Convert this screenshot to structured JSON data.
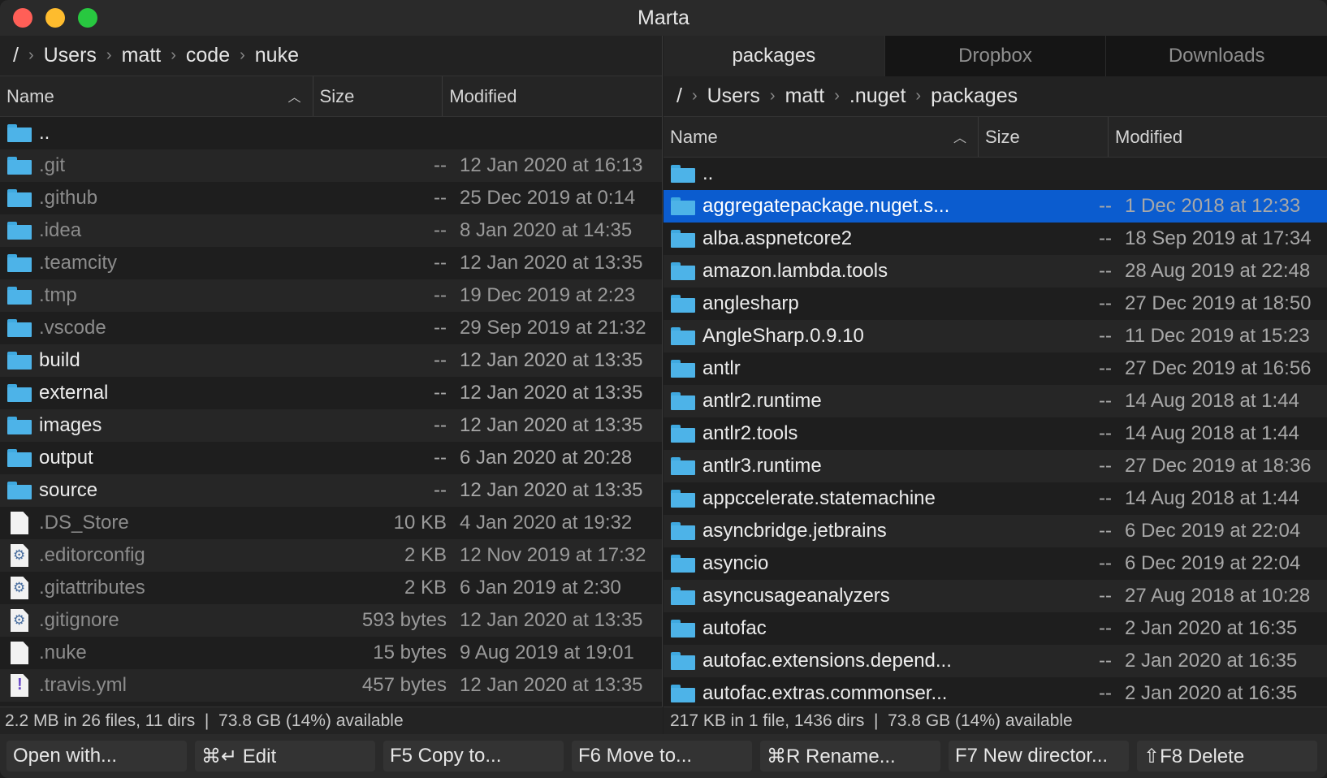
{
  "window": {
    "title": "Marta"
  },
  "left_pane": {
    "breadcrumb": [
      "/",
      "Users",
      "matt",
      "code",
      "nuke"
    ],
    "columns": {
      "name": "Name",
      "size": "Size",
      "modified": "Modified"
    },
    "rows": [
      {
        "icon": "folder-icon",
        "name": "..",
        "size": "",
        "modified": "",
        "style": "bright"
      },
      {
        "icon": "folder-icon",
        "name": ".git",
        "size": "--",
        "modified": "12 Jan 2020 at 16:13",
        "style": "dim"
      },
      {
        "icon": "folder-icon",
        "name": ".github",
        "size": "--",
        "modified": "25 Dec 2019 at 0:14",
        "style": "dim"
      },
      {
        "icon": "folder-icon",
        "name": ".idea",
        "size": "--",
        "modified": "8 Jan 2020 at 14:35",
        "style": "dim"
      },
      {
        "icon": "folder-icon",
        "name": ".teamcity",
        "size": "--",
        "modified": "12 Jan 2020 at 13:35",
        "style": "dim"
      },
      {
        "icon": "folder-icon",
        "name": ".tmp",
        "size": "--",
        "modified": "19 Dec 2019 at 2:23",
        "style": "dim"
      },
      {
        "icon": "folder-icon",
        "name": ".vscode",
        "size": "--",
        "modified": "29 Sep 2019 at 21:32",
        "style": "dim"
      },
      {
        "icon": "folder-icon",
        "name": "build",
        "size": "--",
        "modified": "12 Jan 2020 at 13:35",
        "style": "bright"
      },
      {
        "icon": "folder-icon",
        "name": "external",
        "size": "--",
        "modified": "12 Jan 2020 at 13:35",
        "style": "bright"
      },
      {
        "icon": "folder-icon",
        "name": "images",
        "size": "--",
        "modified": "12 Jan 2020 at 13:35",
        "style": "bright"
      },
      {
        "icon": "folder-icon",
        "name": "output",
        "size": "--",
        "modified": "6 Jan 2020 at 20:28",
        "style": "bright"
      },
      {
        "icon": "folder-icon",
        "name": "source",
        "size": "--",
        "modified": "12 Jan 2020 at 13:35",
        "style": "bright"
      },
      {
        "icon": "file-icon",
        "name": ".DS_Store",
        "size": "10 KB",
        "modified": "4 Jan 2020 at 19:32",
        "style": "dim"
      },
      {
        "icon": "config-file-icon",
        "name": ".editorconfig",
        "size": "2 KB",
        "modified": "12 Nov 2019 at 17:32",
        "style": "dim"
      },
      {
        "icon": "config-file-icon",
        "name": ".gitattributes",
        "size": "2 KB",
        "modified": "6 Jan 2019 at 2:30",
        "style": "dim"
      },
      {
        "icon": "config-file-icon",
        "name": ".gitignore",
        "size": "593 bytes",
        "modified": "12 Jan 2020 at 13:35",
        "style": "dim"
      },
      {
        "icon": "file-icon",
        "name": ".nuke",
        "size": "15 bytes",
        "modified": "9 Aug 2019 at 19:01",
        "style": "dim"
      },
      {
        "icon": "yaml-file-icon",
        "name": ".travis.yml",
        "size": "457 bytes",
        "modified": "12 Jan 2020 at 13:35",
        "style": "dim"
      }
    ],
    "status": "2.2 MB in 26 files, 11 dirs  |  73.8 GB (14%) available"
  },
  "right_pane": {
    "tabs": [
      {
        "label": "packages",
        "active": true
      },
      {
        "label": "Dropbox",
        "active": false
      },
      {
        "label": "Downloads",
        "active": false
      }
    ],
    "breadcrumb": [
      "/",
      "Users",
      "matt",
      ".nuget",
      "packages"
    ],
    "columns": {
      "name": "Name",
      "size": "Size",
      "modified": "Modified"
    },
    "rows": [
      {
        "icon": "folder-icon",
        "name": "..",
        "size": "",
        "modified": ""
      },
      {
        "icon": "folder-icon",
        "name": "aggregatepackage.nuget.s...",
        "size": "--",
        "modified": "1 Dec 2018 at 12:33",
        "selected": true
      },
      {
        "icon": "folder-icon",
        "name": "alba.aspnetcore2",
        "size": "--",
        "modified": "18 Sep 2019 at 17:34"
      },
      {
        "icon": "folder-icon",
        "name": "amazon.lambda.tools",
        "size": "--",
        "modified": "28 Aug 2019 at 22:48"
      },
      {
        "icon": "folder-icon",
        "name": "anglesharp",
        "size": "--",
        "modified": "27 Dec 2019 at 18:50"
      },
      {
        "icon": "folder-icon",
        "name": "AngleSharp.0.9.10",
        "size": "--",
        "modified": "11 Dec 2019 at 15:23"
      },
      {
        "icon": "folder-icon",
        "name": "antlr",
        "size": "--",
        "modified": "27 Dec 2019 at 16:56"
      },
      {
        "icon": "folder-icon",
        "name": "antlr2.runtime",
        "size": "--",
        "modified": "14 Aug 2018 at 1:44"
      },
      {
        "icon": "folder-icon",
        "name": "antlr2.tools",
        "size": "--",
        "modified": "14 Aug 2018 at 1:44"
      },
      {
        "icon": "folder-icon",
        "name": "antlr3.runtime",
        "size": "--",
        "modified": "27 Dec 2019 at 18:36"
      },
      {
        "icon": "folder-icon",
        "name": "appccelerate.statemachine",
        "size": "--",
        "modified": "14 Aug 2018 at 1:44"
      },
      {
        "icon": "folder-icon",
        "name": "asyncbridge.jetbrains",
        "size": "--",
        "modified": "6 Dec 2019 at 22:04"
      },
      {
        "icon": "folder-icon",
        "name": "asyncio",
        "size": "--",
        "modified": "6 Dec 2019 at 22:04"
      },
      {
        "icon": "folder-icon",
        "name": "asyncusageanalyzers",
        "size": "--",
        "modified": "27 Aug 2018 at 10:28"
      },
      {
        "icon": "folder-icon",
        "name": "autofac",
        "size": "--",
        "modified": "2 Jan 2020 at 16:35"
      },
      {
        "icon": "folder-icon",
        "name": "autofac.extensions.depend...",
        "size": "--",
        "modified": "2 Jan 2020 at 16:35"
      },
      {
        "icon": "folder-icon",
        "name": "autofac.extras.commonser...",
        "size": "--",
        "modified": "2 Jan 2020 at 16:35"
      }
    ],
    "status": "217 KB in 1 file, 1436 dirs  |  73.8 GB (14%) available"
  },
  "toolbar": {
    "buttons": [
      "Open with...",
      "⌘↵ Edit",
      "F5 Copy to...",
      "F6 Move to...",
      "⌘R Rename...",
      "F7 New director...",
      "⇧F8 Delete"
    ]
  }
}
